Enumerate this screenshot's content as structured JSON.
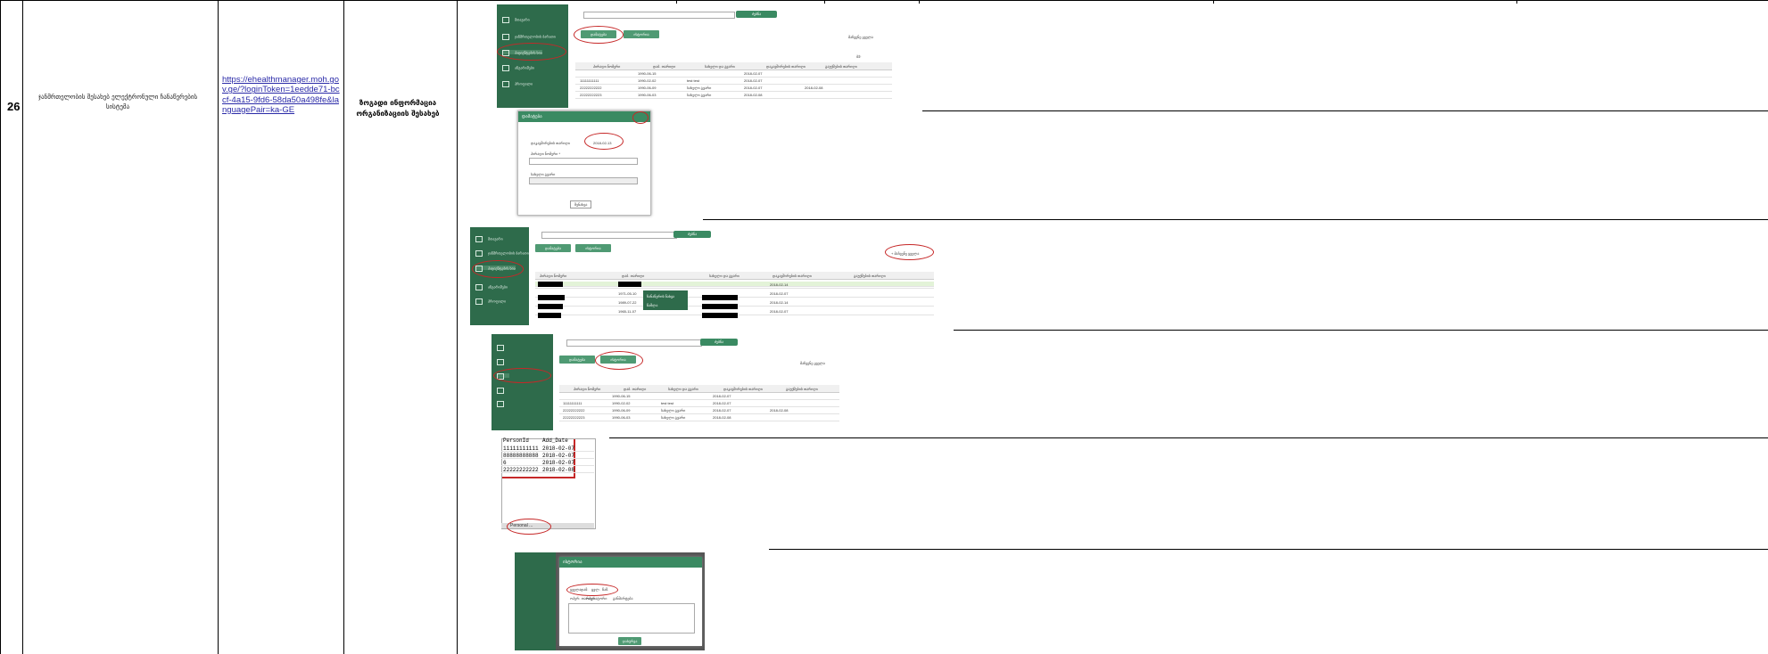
{
  "row": {
    "number": "26",
    "description": "ჯანმრთელობის შესახებ ელექტრონული ჩანაწერების სისტემა",
    "url": "https://ehealthmanager.moh.gov.ge/?loginToken=1eedde71-bccf-4a15-9fd6-58da50a498fe&languagePair=ka-GE",
    "name": "ზოგადი ინფორმაცია ორგანიზაციის შესახებ"
  },
  "screens": {
    "s1": {
      "search_btn": "ძებნა",
      "btn_add": "დამატება",
      "btn_view": "ისტორია",
      "show_label": "მაჩვენე ყველა",
      "page_label": "გვ.",
      "sidebar": [
        "მთავარი",
        "ჯანმრთელობის ბარათი",
        "პაციენტების სია",
        "ანგარიშები",
        "პროფილი"
      ],
      "headers": [
        "პირადი ნომერი",
        "დაბ. თარიღი",
        "სახელი და გვარი",
        "დაკავშირების თარიღი",
        "გაუქმების თარიღი"
      ],
      "rows": [
        [
          "",
          "1990-06-15",
          "",
          "2018-02-07",
          ""
        ],
        [
          "11111111111",
          "1990-02-02",
          "test test",
          "2018-02-07",
          ""
        ],
        [
          "22222222222",
          "1990-06-09",
          "სახელი გვარი",
          "2018-02-07",
          "2018-02-08"
        ],
        [
          "22222222223",
          "1990-06-03",
          "სახელი გვარი",
          "2018-02-08",
          ""
        ]
      ]
    },
    "modal1": {
      "title": "დამატება",
      "date_label": "დაკავშირების თარიღი",
      "date_value": "2018-02-13",
      "id_label": "პირადი ნომერი *",
      "name_label": "სახელი გვარი",
      "save": "შენახვა"
    },
    "s2": {
      "search_btn": "ძებნა",
      "btn_add": "დამატება",
      "btn_view": "ისტორია",
      "show_all": "+ მაჩვენე ყველა",
      "menu": [
        "ჩანაწერის ნახვა",
        "წაშლა"
      ],
      "headers": [
        "პირადი ნომერი",
        "დაბ. თარიღი",
        "სახელი და გვარი",
        "დაკავშირების თარიღი",
        "გაუქმების თარიღი"
      ],
      "rows": [
        [
          "",
          "",
          "",
          "2018-02-14",
          ""
        ],
        [
          "",
          "1971-05-10",
          "",
          "2018-02-07",
          ""
        ],
        [
          "",
          "1989-07-22",
          "",
          "2018-02-14",
          ""
        ],
        [
          "",
          "1965-11-07",
          "",
          "2018-02-07",
          ""
        ]
      ]
    },
    "s3": {
      "search_btn": "ძებნა",
      "btn_add": "დამატება",
      "btn_view": "ისტორია",
      "show_label": "მაჩვენე ყველა",
      "headers": [
        "პირადი ნომერი",
        "დაბ. თარიღი",
        "სახელი და გვარი",
        "დაკავშირების თარიღი",
        "გაუქმების თარიღი"
      ],
      "rows": [
        [
          "",
          "1990-06-15",
          "",
          "2018-02-07",
          ""
        ],
        [
          "11111111111",
          "1990-02-02",
          "test test",
          "2018-02-07",
          ""
        ],
        [
          "22222222222",
          "1990-06-09",
          "სახელი გვარი",
          "2018-02-07",
          "2018-02-08"
        ],
        [
          "22222222223",
          "1990-06-03",
          "სახელი გვარი",
          "2018-02-08",
          ""
        ]
      ]
    },
    "excel": {
      "headers": [
        "PersonId",
        "Add_Date"
      ],
      "rows": [
        [
          "11111111111",
          "2018-02-07"
        ],
        [
          "88888888888",
          "2018-02-07"
        ],
        [
          "6",
          "2018-02-07"
        ],
        [
          "22222222222",
          "2018-02-08"
        ]
      ],
      "sheet_tab": "Personal ..."
    },
    "s4": {
      "title": "ისტორია",
      "tabs": [
        "ყველა",
        "დამ.",
        "ცვლ.",
        "წაშ."
      ],
      "col_headers": [
        "ოპერ. თარიღი",
        "ოპერატორი",
        "განმარტება"
      ],
      "close": "დახურვა"
    }
  }
}
